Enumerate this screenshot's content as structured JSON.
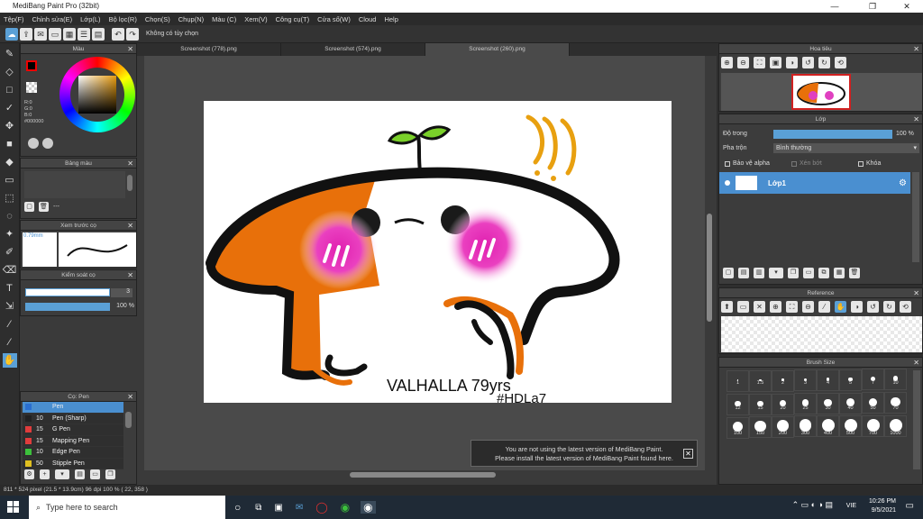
{
  "window": {
    "title": "MediBang Paint Pro (32bit)",
    "min": "—",
    "max": "❐",
    "close": "✕"
  },
  "menu": [
    "Tệp(F)",
    "Chỉnh sửa(E)",
    "Lớp(L)",
    "Bộ lọc(R)",
    "Chọn(S)",
    "Chụp(N)",
    "Màu (C)",
    "Xem(V)",
    "Công cụ(T)",
    "Cửa sổ(W)",
    "Cloud",
    "Help"
  ],
  "toolbar": {
    "option_text": "Không có tùy chọn"
  },
  "tabs": [
    "Screenshot (778).png",
    "Screenshot (574).png",
    "Screenshot (260).png"
  ],
  "color_panel": {
    "title": "Màu",
    "r": "R:0",
    "g": "G:0",
    "b": "B:0",
    "hex": "#000000"
  },
  "palette_panel": {
    "title": "Bảng màu",
    "extra": "---"
  },
  "preview_panel": {
    "title": "Xem trước cọ",
    "size": "0.79mm"
  },
  "brush_control": {
    "title": "Kiểm soát cọ",
    "size": "3",
    "opacity": "100 %"
  },
  "brush_panel": {
    "title": "Cọ: Pen",
    "items": [
      {
        "size": "",
        "name": "Pen",
        "color": "#2a6fd0"
      },
      {
        "size": "10",
        "name": "Pen (Sharp)",
        "color": "#222222"
      },
      {
        "size": "15",
        "name": "G Pen",
        "color": "#e03c3c"
      },
      {
        "size": "15",
        "name": "Mapping Pen",
        "color": "#e03c3c"
      },
      {
        "size": "10",
        "name": "Edge Pen",
        "color": "#3cc03c"
      },
      {
        "size": "50",
        "name": "Stipple Pen",
        "color": "#e0c020"
      }
    ]
  },
  "navigator": {
    "title": "Hoa tiêu"
  },
  "layer_panel": {
    "title": "Lớp",
    "opacity_label": "Độ trong",
    "opacity_value": "100 %",
    "blend_label": "Pha trộn",
    "blend_value": "Bình thường",
    "protect_alpha": "Bảo vệ alpha",
    "clipping": "Xén bớt",
    "lock": "Khóa",
    "layer_name": "Lớp1"
  },
  "reference_panel": {
    "title": "Reference"
  },
  "brushsize_panel": {
    "title": "Brush Size",
    "sizes": [
      "1",
      "1.5",
      "2",
      "3",
      "4",
      "5",
      "7",
      "10",
      "12",
      "15",
      "20",
      "25",
      "30",
      "40",
      "50",
      "70",
      "100",
      "150",
      "200",
      "300",
      "400",
      "500",
      "700",
      "1000"
    ]
  },
  "canvas": {
    "handwriting1": "VALHALLA 79yrs",
    "handwriting2": "#HDLa7"
  },
  "notification": {
    "line1": "You are not using the latest version of MediBang Paint.",
    "line2": "Please install the latest version of MediBang Paint found here."
  },
  "status": {
    "text": "811 * 524 pixel   (21.5 * 13.9cm)   96 dpi   100 %   ( 22, 358 )"
  },
  "taskbar": {
    "search_placeholder": "Type here to search",
    "time": "10:26 PM",
    "date": "9/5/2021",
    "lang": "VIE"
  }
}
